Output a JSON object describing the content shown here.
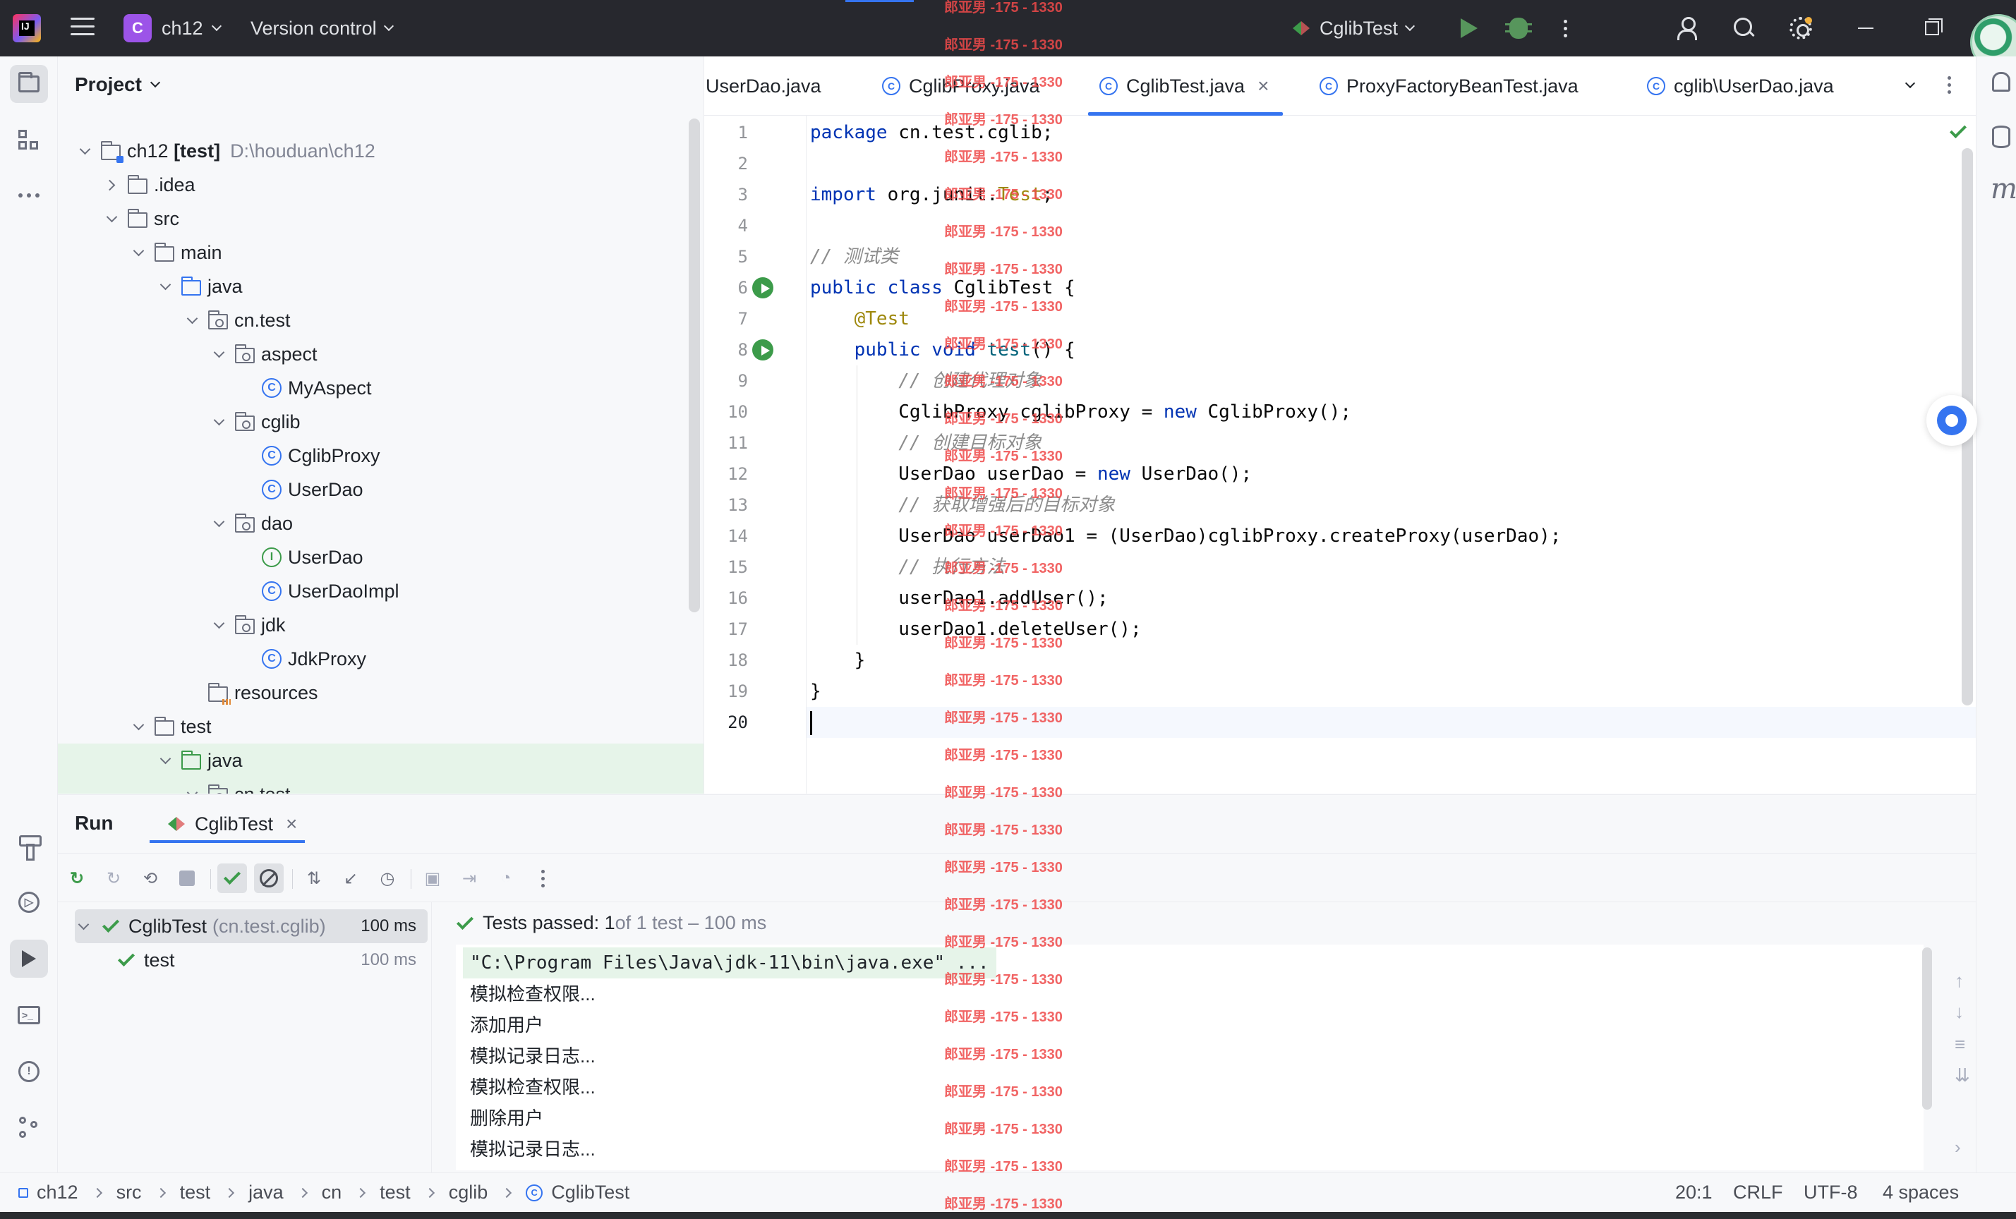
{
  "titlebar": {
    "logo_text": "IJ",
    "project_badge": "C",
    "project_name": "ch12",
    "version_control": "Version control",
    "run_config": "CglibTest"
  },
  "project_panel": {
    "title": "Project",
    "tree": [
      {
        "label": "ch12 [test]",
        "path": "D:\\houduan\\ch12",
        "depth": 0,
        "expanded": true,
        "icon": "module-folder-icon"
      },
      {
        "label": ".idea",
        "depth": 1,
        "expanded": false,
        "icon": "folder-icon"
      },
      {
        "label": "src",
        "depth": 1,
        "expanded": true,
        "icon": "folder-icon"
      },
      {
        "label": "main",
        "depth": 2,
        "expanded": true,
        "icon": "folder-icon"
      },
      {
        "label": "java",
        "depth": 3,
        "expanded": true,
        "icon": "source-folder-icon"
      },
      {
        "label": "cn.test",
        "depth": 4,
        "expanded": true,
        "icon": "package-icon"
      },
      {
        "label": "aspect",
        "depth": 5,
        "expanded": true,
        "icon": "package-icon"
      },
      {
        "label": "MyAspect",
        "depth": 6,
        "icon": "class-icon"
      },
      {
        "label": "cglib",
        "depth": 5,
        "expanded": true,
        "icon": "package-icon"
      },
      {
        "label": "CglibProxy",
        "depth": 6,
        "icon": "class-icon"
      },
      {
        "label": "UserDao",
        "depth": 6,
        "icon": "class-icon"
      },
      {
        "label": "dao",
        "depth": 5,
        "expanded": true,
        "icon": "package-icon"
      },
      {
        "label": "UserDao",
        "depth": 6,
        "icon": "interface-icon"
      },
      {
        "label": "UserDaoImpl",
        "depth": 6,
        "icon": "class-icon"
      },
      {
        "label": "jdk",
        "depth": 5,
        "expanded": true,
        "icon": "package-icon"
      },
      {
        "label": "JdkProxy",
        "depth": 6,
        "icon": "class-icon"
      },
      {
        "label": "resources",
        "depth": 4,
        "icon": "resources-folder-icon"
      },
      {
        "label": "test",
        "depth": 2,
        "expanded": true,
        "icon": "folder-icon"
      },
      {
        "label": "java",
        "depth": 3,
        "expanded": true,
        "icon": "test-folder-icon",
        "selected": true
      },
      {
        "label": "cn.test",
        "depth": 4,
        "expanded": true,
        "icon": "package-icon",
        "selected": true
      }
    ]
  },
  "editor": {
    "tabs": [
      {
        "label": "UserDao.java",
        "icon": "class-icon",
        "partial": true
      },
      {
        "label": "CglibProxy.java",
        "icon": "class-icon"
      },
      {
        "label": "CglibTest.java",
        "icon": "class-icon",
        "active": true,
        "close": "×"
      },
      {
        "label": "ProxyFactoryBeanTest.java",
        "icon": "class-icon"
      },
      {
        "label": "cglib\\UserDao.java",
        "icon": "class-icon"
      }
    ],
    "current_line": 20,
    "lines": [
      [
        {
          "t": "package ",
          "c": "kw"
        },
        {
          "t": "cn.test.cglib;"
        }
      ],
      [],
      [
        {
          "t": "import ",
          "c": "kw"
        },
        {
          "t": "org.junit."
        },
        {
          "t": "Test",
          "c": "ann"
        },
        {
          "t": ";"
        }
      ],
      [],
      [
        {
          "t": "// 测试类",
          "c": "cm"
        }
      ],
      [
        {
          "t": "public class ",
          "c": "kw"
        },
        {
          "t": "CglibTest {"
        }
      ],
      [
        {
          "t": "    "
        },
        {
          "t": "@Test",
          "c": "ann"
        }
      ],
      [
        {
          "t": "    "
        },
        {
          "t": "public void ",
          "c": "kw"
        },
        {
          "t": "test",
          "c": "fn"
        },
        {
          "t": "() {"
        }
      ],
      [
        {
          "t": "        "
        },
        {
          "t": "// 创建代理对象",
          "c": "cm"
        }
      ],
      [
        {
          "t": "        CglibProxy cglibProxy = "
        },
        {
          "t": "new ",
          "c": "kw"
        },
        {
          "t": "CglibProxy();"
        }
      ],
      [
        {
          "t": "        "
        },
        {
          "t": "// 创建目标对象",
          "c": "cm"
        }
      ],
      [
        {
          "t": "        UserDao userDao = "
        },
        {
          "t": "new ",
          "c": "kw"
        },
        {
          "t": "UserDao();"
        }
      ],
      [
        {
          "t": "        "
        },
        {
          "t": "// 获取增强后的目标对象",
          "c": "cm"
        }
      ],
      [
        {
          "t": "        UserDao userDao1 = (UserDao)cglibProxy.createProxy(userDao);"
        }
      ],
      [
        {
          "t": "        "
        },
        {
          "t": "// 执行方法",
          "c": "cm"
        }
      ],
      [
        {
          "t": "        userDao1.addUser();"
        }
      ],
      [
        {
          "t": "        userDao1.deleteUser();"
        }
      ],
      [
        {
          "t": "    }"
        }
      ],
      [
        {
          "t": "}"
        }
      ],
      []
    ]
  },
  "run_panel": {
    "title": "Run",
    "tab_label": "CglibTest",
    "tab_close": "×",
    "tests": [
      {
        "label": "CglibTest",
        "detail": "(cn.test.cglib)",
        "time": "100 ms"
      },
      {
        "label": "test",
        "time": "100 ms"
      }
    ],
    "status_passed": "Tests passed: 1",
    "status_rest": " of 1 test – 100 ms",
    "console": [
      "\"C:\\Program Files\\Java\\jdk-11\\bin\\java.exe\" ...",
      "模拟检查权限...",
      "添加用户",
      "模拟记录日志...",
      "模拟检查权限...",
      "删除用户",
      "模拟记录日志..."
    ]
  },
  "statusbar": {
    "breadcrumb": [
      "ch12",
      "src",
      "test",
      "java",
      "cn",
      "test",
      "cglib",
      "CglibTest"
    ],
    "position": "20:1",
    "line_sep": "CRLF",
    "encoding": "UTF-8",
    "indent": "4 spaces"
  },
  "watermark": "郎亚男 -175 - 1330",
  "colors": {
    "accent": "#3574f0",
    "success": "#3c9b4a",
    "keyword": "#0033b3",
    "comment": "#8c8c8c",
    "annotation": "#9e880d",
    "watermark": "#ef4a4a"
  }
}
